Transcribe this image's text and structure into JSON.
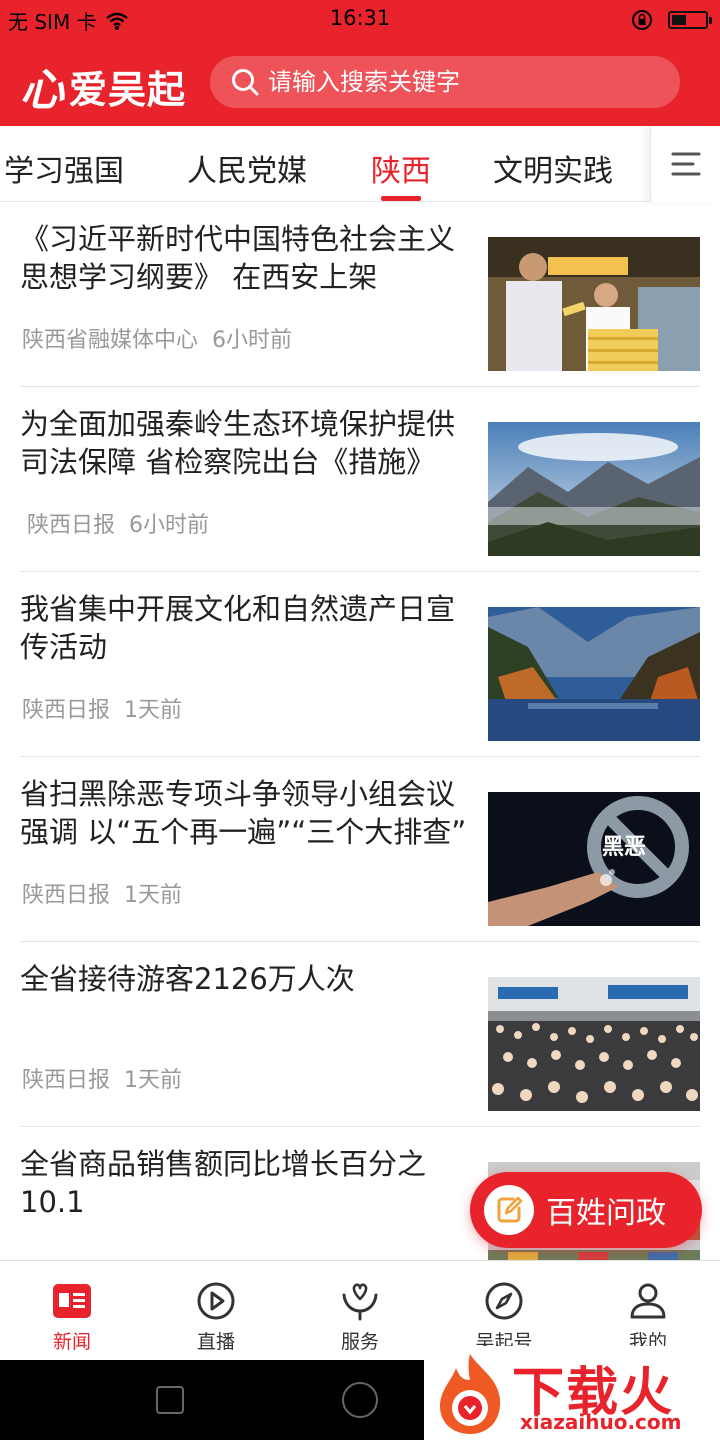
{
  "status_bar": {
    "carrier": "无 SIM 卡",
    "time": "16:31"
  },
  "header": {
    "logo_text": "爱吴起",
    "logo_mark": "心",
    "search_placeholder": "请输入搜索关键字"
  },
  "tabs": [
    {
      "label": "学习强国",
      "active": false
    },
    {
      "label": "人民党媒",
      "active": false
    },
    {
      "label": "陕西",
      "active": true
    },
    {
      "label": "文明实践",
      "active": false
    }
  ],
  "news": [
    {
      "title": "《习近平新时代中国特色社会主义思想学习纲要》 在西安上架",
      "source": "陕西省融媒体中心",
      "time": "6小时前"
    },
    {
      "title": "为全面加强秦岭生态环境保护提供司法保障  省检察院出台《措施》",
      "source": "陕西日报",
      "time": "6小时前"
    },
    {
      "title": "我省集中开展文化和自然遗产日宣传活动",
      "source": "陕西日报",
      "time": "1天前"
    },
    {
      "title": "省扫黑除恶专项斗争领导小组会议强调 以“五个再一遍”“三个大排查”",
      "source": "陕西日报",
      "time": "1天前"
    },
    {
      "title": "全省接待游客2126万人次",
      "source": "陕西日报",
      "time": "1天前"
    },
    {
      "title": "全省商品销售额同比增长百分之10.1",
      "source": "",
      "time": ""
    }
  ],
  "thumbs": {
    "t4_text": "黑恶"
  },
  "float_button": {
    "label": "百姓问政"
  },
  "bottom_nav": [
    {
      "label": "新闻",
      "icon": "news-icon",
      "active": true
    },
    {
      "label": "直播",
      "icon": "play-icon",
      "active": false
    },
    {
      "label": "服务",
      "icon": "service-icon",
      "active": false
    },
    {
      "label": "吴起号",
      "icon": "compass-icon",
      "active": false
    },
    {
      "label": "我的",
      "icon": "user-icon",
      "active": false
    }
  ],
  "watermark": {
    "text": "下载火",
    "url": "xiazaihuo.com"
  },
  "colors": {
    "brand": "#e8232b",
    "meta": "#999999"
  }
}
